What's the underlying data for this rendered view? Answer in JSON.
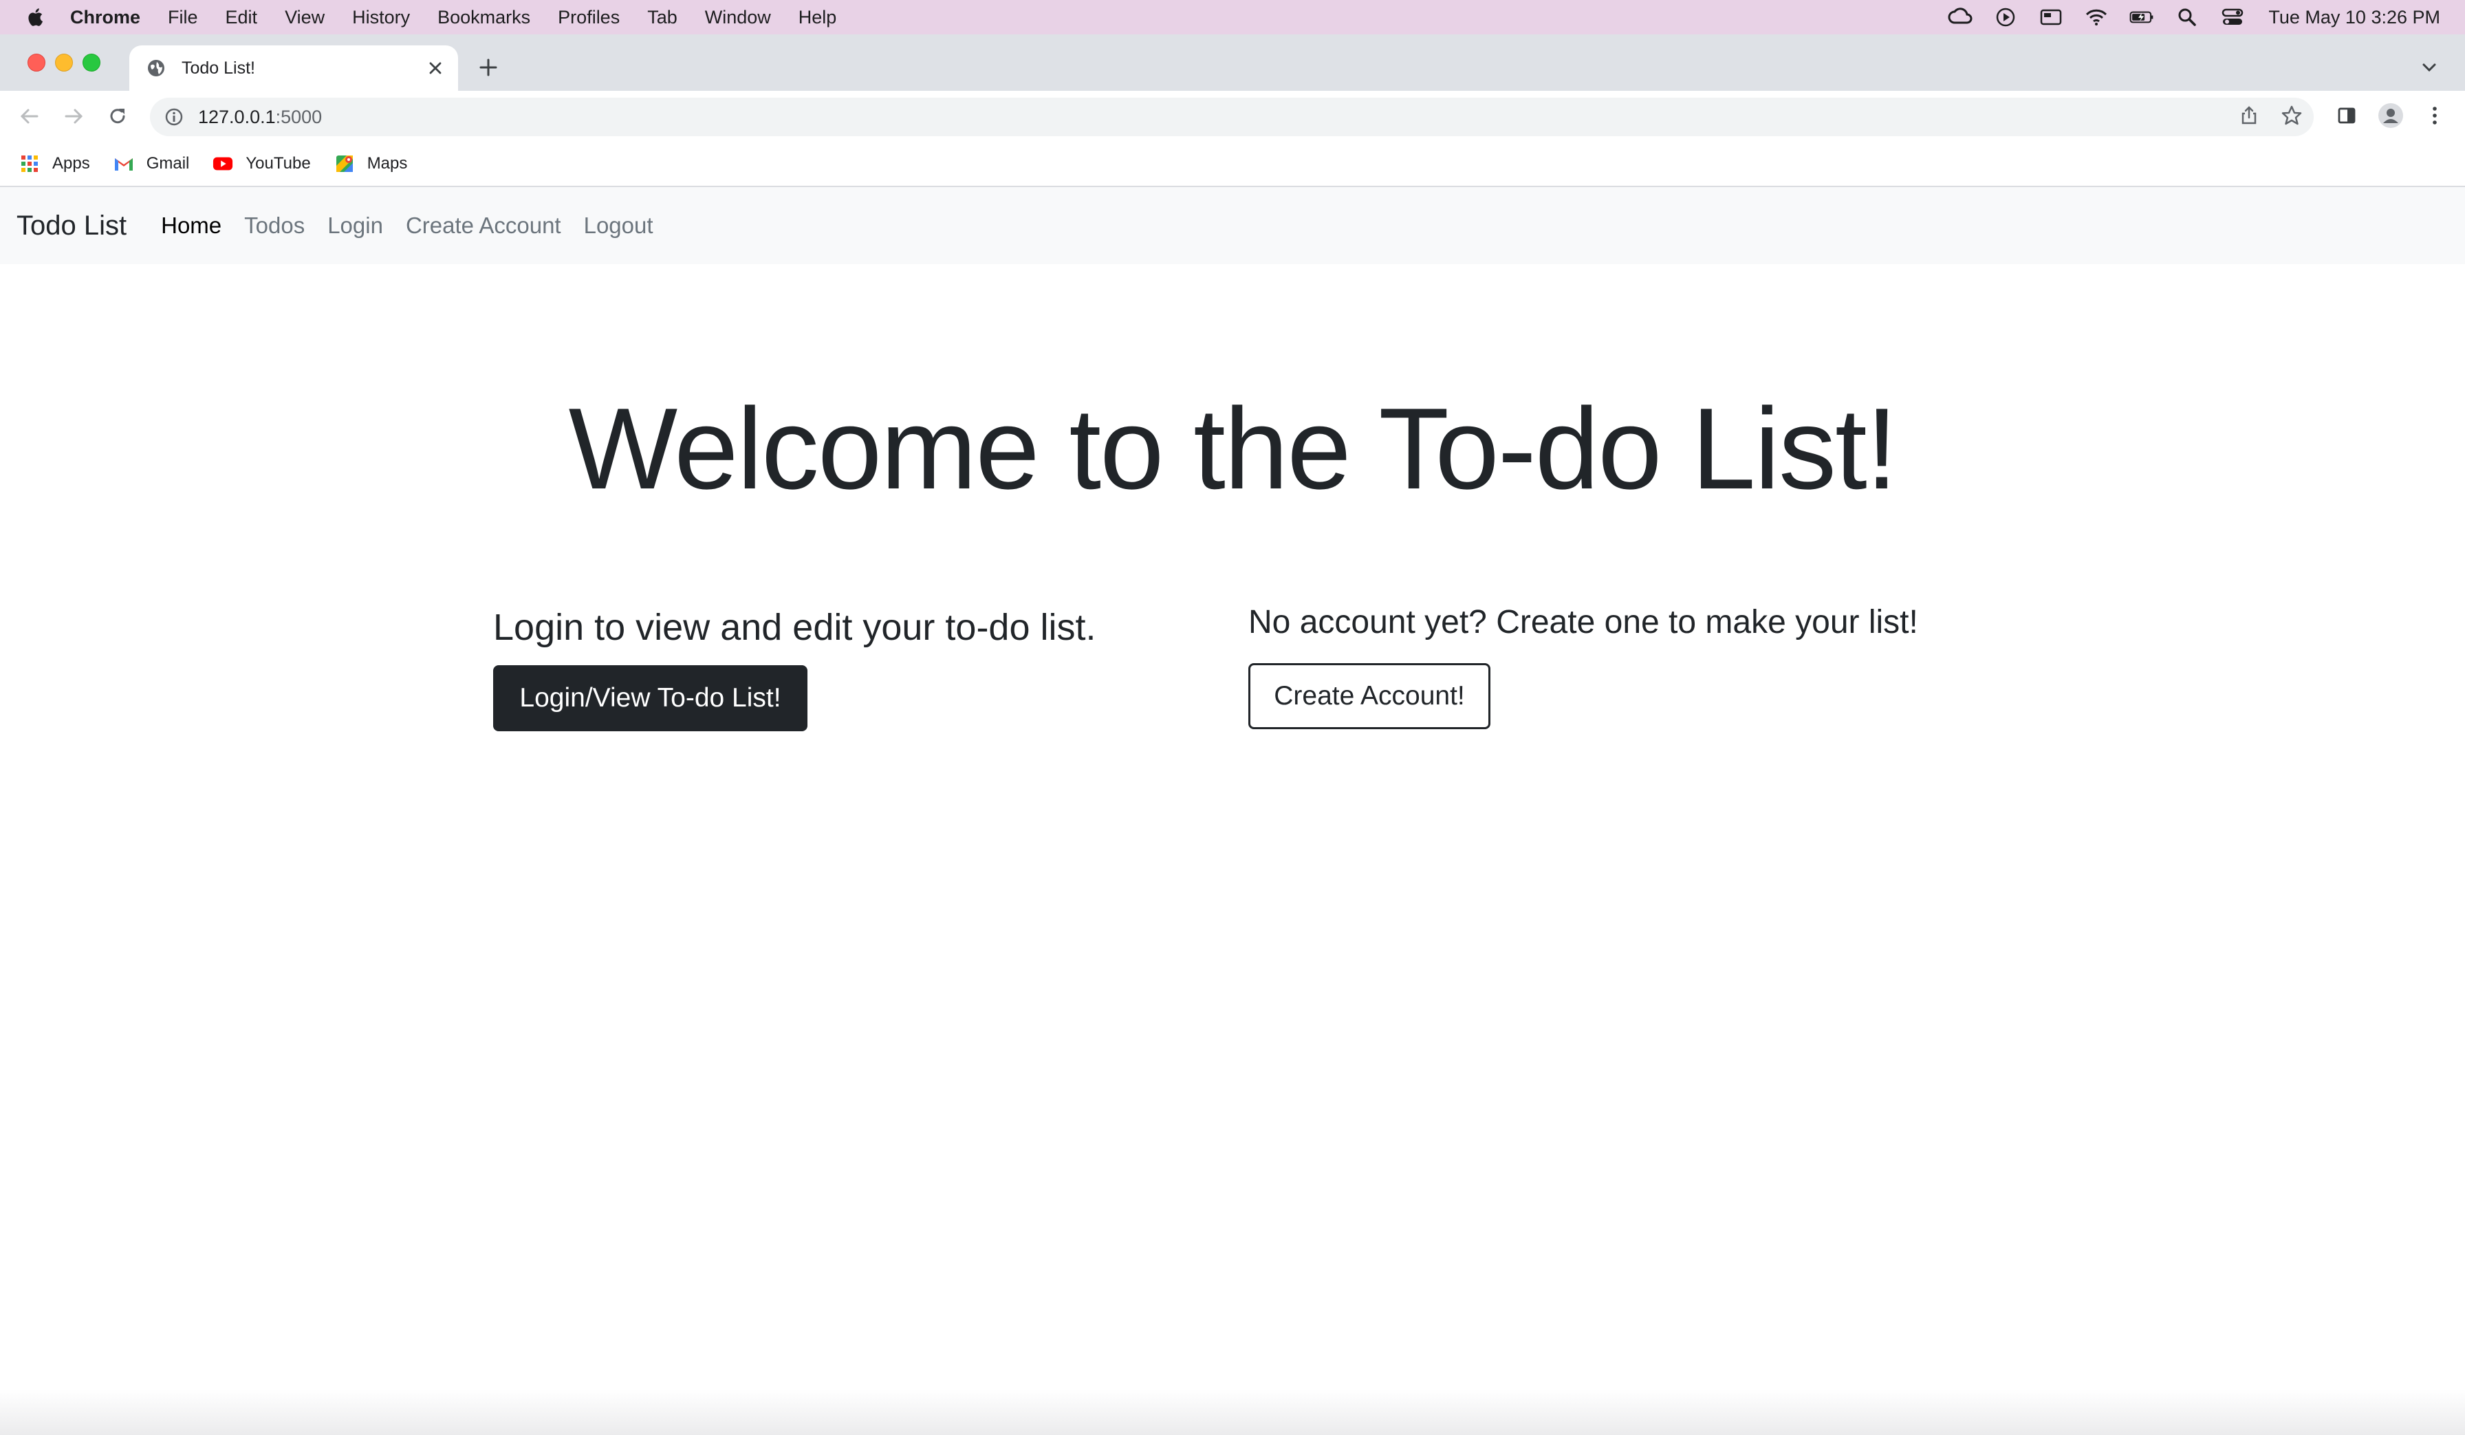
{
  "menubar": {
    "app_name": "Chrome",
    "items": [
      "File",
      "Edit",
      "View",
      "History",
      "Bookmarks",
      "Profiles",
      "Tab",
      "Window",
      "Help"
    ],
    "clock": "Tue May 10  3:26 PM"
  },
  "browser": {
    "tab": {
      "title": "Todo List!"
    },
    "url": {
      "host": "127.0.0.1",
      "port": ":5000"
    },
    "bookmarks": [
      {
        "label": "Apps",
        "icon": "apps-grid-icon"
      },
      {
        "label": "Gmail",
        "icon": "gmail-icon"
      },
      {
        "label": "YouTube",
        "icon": "youtube-icon"
      },
      {
        "label": "Maps",
        "icon": "maps-icon"
      }
    ]
  },
  "navbar": {
    "brand": "Todo List",
    "links": [
      "Home",
      "Todos",
      "Login",
      "Create Account",
      "Logout"
    ],
    "active": "Home"
  },
  "main": {
    "title": "Welcome to the To-do List!",
    "login_heading": "Login to view and edit your to-do list.",
    "login_button": "Login/View To-do List!",
    "signup_heading": "No account yet? Create one to make your list!",
    "signup_button": "Create Account!"
  },
  "colors": {
    "menubar_bg": "#e8d2e6",
    "navbar_bg": "#f8f9fa",
    "dark_button": "#212529",
    "nav_link_muted": "#6c757d"
  }
}
